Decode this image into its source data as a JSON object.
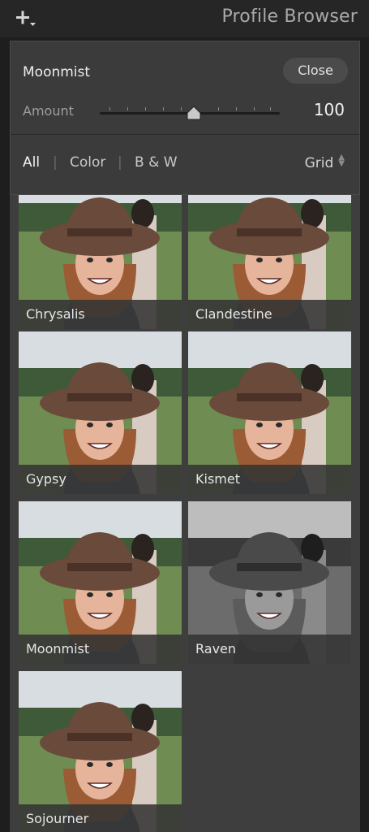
{
  "header": {
    "title": "Profile Browser",
    "add_icon": "plus-with-dropdown-icon"
  },
  "profile": {
    "name": "Moonmist",
    "close_label": "Close",
    "amount_label": "Amount",
    "amount_value": "100"
  },
  "filters": {
    "all": "All",
    "color": "Color",
    "bw": "B & W",
    "view": "Grid",
    "active": "All"
  },
  "profiles": [
    {
      "name": "Chrysalis",
      "style": "color",
      "selected": false
    },
    {
      "name": "Clandestine",
      "style": "color",
      "selected": false
    },
    {
      "name": "Gypsy",
      "style": "color",
      "selected": false
    },
    {
      "name": "Kismet",
      "style": "color",
      "selected": false
    },
    {
      "name": "Moonmist",
      "style": "color",
      "selected": true
    },
    {
      "name": "Raven",
      "style": "bw",
      "selected": false
    },
    {
      "name": "Sojourner",
      "style": "color",
      "selected": false
    }
  ],
  "colors": {
    "selected_outline": "#d9d9d9",
    "panel_bg": "#3b3b3b",
    "header_bg": "#262626"
  }
}
